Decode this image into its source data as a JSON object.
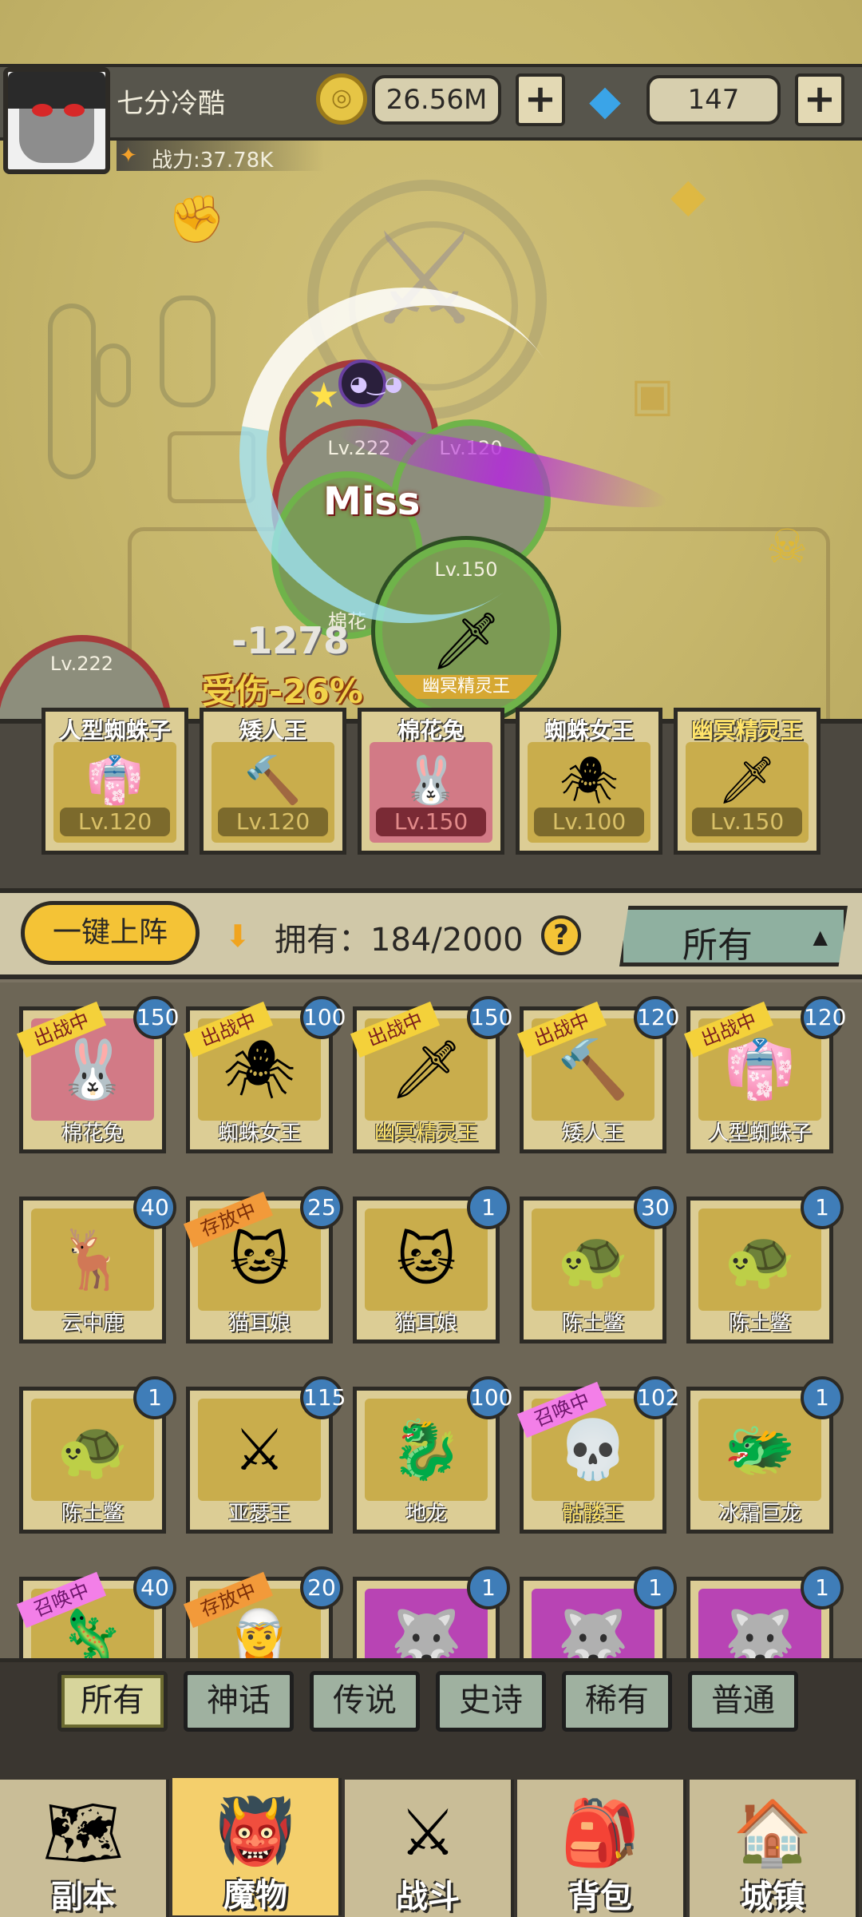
{
  "header": {
    "player_name": "七分冷酷",
    "power_label": "战力:37.78K",
    "gold": "26.56M",
    "gems": "147",
    "plus_label": "+"
  },
  "battle": {
    "enemy_units": [
      {
        "level": "Lv.222"
      },
      {
        "level": "Lv.222"
      },
      {
        "level": "Lv.222"
      }
    ],
    "unit_120": {
      "level": "Lv.120"
    },
    "unit_active": {
      "level": "Lv.150",
      "name": "幽冥精灵王"
    },
    "unit_partial_level": "Lv.2",
    "miss_text": "Miss",
    "damage_text": "-1278",
    "hurt_text": "受伤-26%",
    "partial_name": "棉花"
  },
  "team": [
    {
      "name": "人型蜘蛛子",
      "level": "Lv.120",
      "icon": "hooded-figure"
    },
    {
      "name": "矮人王",
      "level": "Lv.120",
      "icon": "dwarf-king"
    },
    {
      "name": "棉花兔",
      "level": "Lv.150",
      "icon": "bunny-girl"
    },
    {
      "name": "蜘蛛女王",
      "level": "Lv.100",
      "icon": "spider-queen"
    },
    {
      "name": "幽冥精灵王",
      "level": "Lv.150",
      "icon": "ghost-elf-king"
    }
  ],
  "toolbar": {
    "deploy_label": "一键上阵",
    "own_label": "拥有：184/2000",
    "help_label": "?",
    "filter_label": "所有"
  },
  "monsters": [
    {
      "name": "棉花兔",
      "count": "150",
      "tag": "出战中"
    },
    {
      "name": "蜘蛛女王",
      "count": "100",
      "tag": "出战中"
    },
    {
      "name": "幽冥精灵王",
      "count": "150",
      "tag": "出战中"
    },
    {
      "name": "矮人王",
      "count": "120",
      "tag": "出战中"
    },
    {
      "name": "人型蜘蛛子",
      "count": "120",
      "tag": "出战中"
    },
    {
      "name": "云中鹿",
      "count": "40",
      "tag": ""
    },
    {
      "name": "猫耳娘",
      "count": "25",
      "tag": "存放中"
    },
    {
      "name": "猫耳娘",
      "count": "1",
      "tag": ""
    },
    {
      "name": "陈土鳖",
      "count": "30",
      "tag": ""
    },
    {
      "name": "陈土鳖",
      "count": "1",
      "tag": ""
    },
    {
      "name": "陈土鳖",
      "count": "1",
      "tag": ""
    },
    {
      "name": "亚瑟王",
      "count": "115",
      "tag": ""
    },
    {
      "name": "地龙",
      "count": "100",
      "tag": ""
    },
    {
      "name": "骷髅王",
      "count": "102",
      "tag": "召唤中"
    },
    {
      "name": "冰霜巨龙",
      "count": "1",
      "tag": ""
    },
    {
      "name": "",
      "count": "40",
      "tag": "召唤中"
    },
    {
      "name": "",
      "count": "20",
      "tag": "存放中"
    },
    {
      "name": "",
      "count": "1",
      "tag": ""
    },
    {
      "name": "",
      "count": "1",
      "tag": ""
    },
    {
      "name": "",
      "count": "1",
      "tag": ""
    }
  ],
  "rarity_tabs": [
    "所有",
    "神话",
    "传说",
    "史诗",
    "稀有",
    "普通"
  ],
  "bottom_nav": [
    "副本",
    "魔物",
    "战斗",
    "背包",
    "城镇"
  ],
  "colors": {
    "accent_gold": "#f4c336",
    "count_badge": "#3f7db8",
    "tag_deployed": "#f4d13a",
    "tag_stored": "#f29a3a",
    "tag_summon": "#f37fe8"
  }
}
